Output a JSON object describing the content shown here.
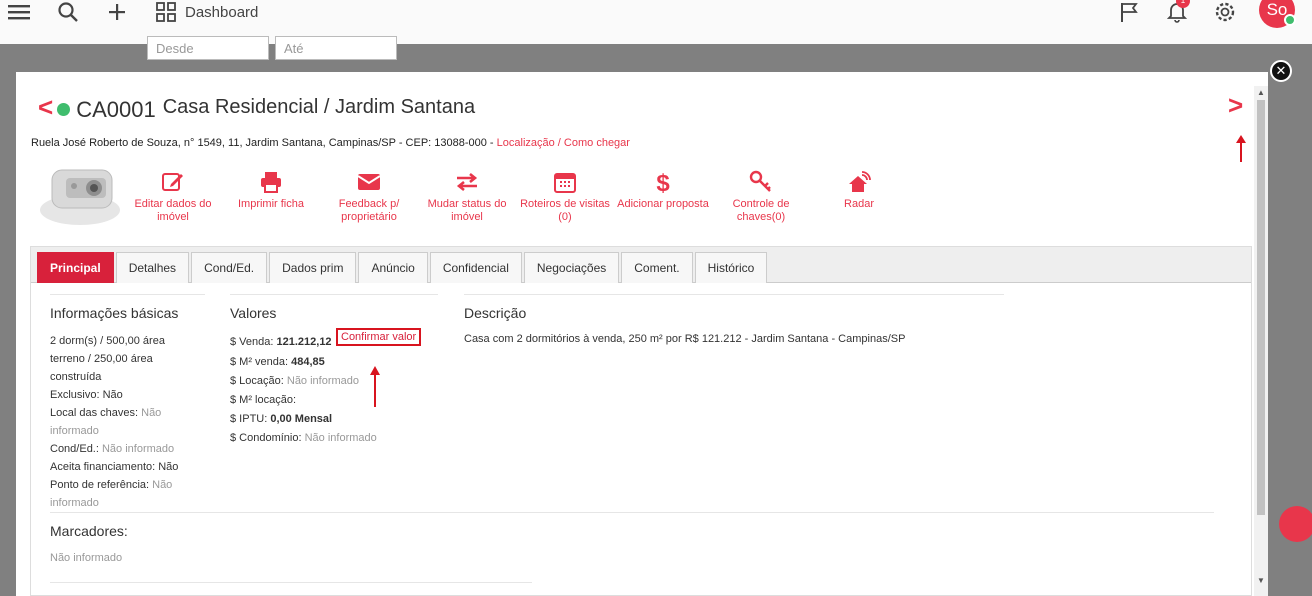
{
  "topbar": {
    "dashboard_label": "Dashboard",
    "filter_from_placeholder": "Desde",
    "filter_to_placeholder": "Até",
    "avatar_initials": "So",
    "bell_count": "1"
  },
  "property": {
    "code": "CA0001",
    "title": "Casa Residencial / Jardim Santana",
    "address": "Ruela José Roberto de Souza, n° 1549, 11, Jardim Santana, Campinas/SP - CEP: 13088-000 - ",
    "location_link": "Localização",
    "separator": " / ",
    "directions_link": "Como chegar"
  },
  "actions": [
    {
      "label": "Editar dados do imóvel",
      "icon": "edit-icon"
    },
    {
      "label": "Imprimir ficha",
      "icon": "printer-icon"
    },
    {
      "label": "Feedback p/ proprietário",
      "icon": "envelope-icon"
    },
    {
      "label": "Mudar status do imóvel",
      "icon": "exchange-icon"
    },
    {
      "label": "Roteiros de visitas (0)",
      "icon": "calendar-icon"
    },
    {
      "label": "Adicionar proposta",
      "icon": "dollar-icon"
    },
    {
      "label": "Controle de chaves(0)",
      "icon": "key-icon"
    },
    {
      "label": "Radar",
      "icon": "radar-house-icon"
    }
  ],
  "tabs": [
    "Principal",
    "Detalhes",
    "Cond/Ed.",
    "Dados prim",
    "Anúncio",
    "Confidencial",
    "Negociações",
    "Coment.",
    "Histórico"
  ],
  "basic": {
    "title": "Informações básicas",
    "summary_1": "2 dorm(s) / 500,00 área",
    "summary_2": "terreno / 250,00 área",
    "summary_3": "construída",
    "exclusive_label": "Exclusivo: ",
    "exclusive_value": "Não",
    "keys_label": "Local das chaves: ",
    "keys_value_1": "Não",
    "keys_value_2": "informado",
    "cond_label": "Cond/Ed.: ",
    "cond_value": "Não informado",
    "financing_label": "Aceita financiamento: ",
    "financing_value": "Não",
    "reference_label": "Ponto de referência: ",
    "reference_value_1": "Não",
    "reference_value_2": "informado"
  },
  "values": {
    "title": "Valores",
    "sale_label": "$ Venda: ",
    "sale_value": "121.212,12",
    "confirm_link": "Confirmar valor",
    "m2_sale_label": "$ M² venda: ",
    "m2_sale_value": "484,85",
    "rent_label": "$ Locação: ",
    "rent_value": "Não informado",
    "m2_rent_label": "$ M² locação:",
    "iptu_label": "$ IPTU: ",
    "iptu_value": "0,00 Mensal",
    "condo_label": "$ Condomínio: ",
    "condo_value": "Não informado"
  },
  "description": {
    "title": "Descrição",
    "text": "Casa com 2 dormitórios à venda, 250 m² por R$ 121.212 - Jardim Santana - Campinas/SP"
  },
  "markers": {
    "title": "Marcadores:",
    "value": "Não informado"
  },
  "colors": {
    "accent": "#e8364b",
    "tab_active": "#d8213b",
    "status_green": "#3fbd6d"
  }
}
